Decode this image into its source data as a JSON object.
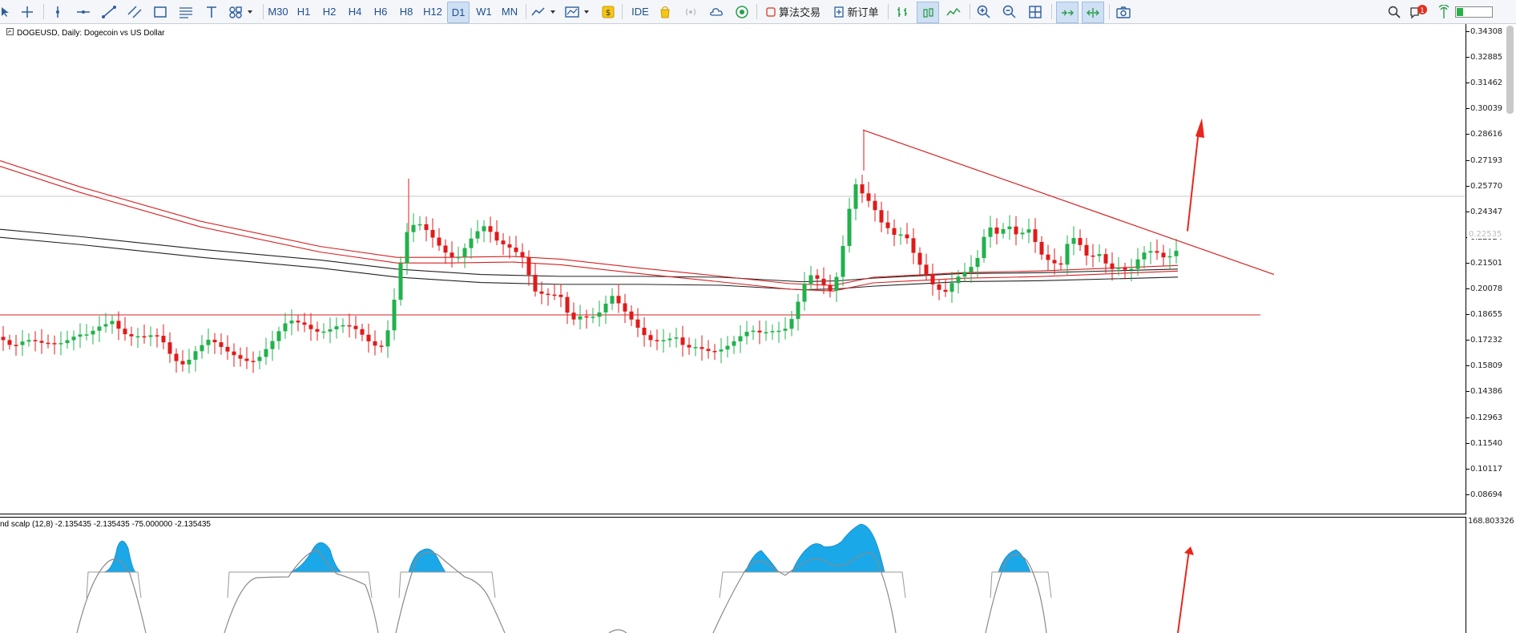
{
  "toolbar": {
    "timeframes": [
      "M30",
      "H1",
      "H2",
      "H4",
      "H6",
      "H8",
      "H12",
      "D1",
      "W1",
      "MN"
    ],
    "active_timeframe": "D1",
    "ide_label": "IDE",
    "algo_trading_label": "算法交易",
    "new_order_label": "新订单",
    "notification_count": "1"
  },
  "chart": {
    "title": "DOGEUSD, Daily:  Dogecoin vs US Dollar",
    "current_price_label": "0.22535",
    "price_scale": [
      "0.34308",
      "0.32885",
      "0.31462",
      "0.30039",
      "0.28616",
      "0.27193",
      "0.25770",
      "0.24347",
      "0.22924",
      "0.21501",
      "0.20078",
      "0.18655",
      "0.17232",
      "0.15809",
      "0.14386",
      "0.12963",
      "0.11540",
      "0.10117",
      "0.08694"
    ],
    "accent_colors": {
      "bull": "#22b14c",
      "bear": "#e01a1a",
      "trendline": "#d62020",
      "arrow": "#e8261b",
      "histogram": "#1aa8e8"
    }
  },
  "indicator": {
    "title": "nd scalp (12,8) -2.135435 -2.135435 -75.000000 -2.135435",
    "scale_value": "168.803326"
  }
}
